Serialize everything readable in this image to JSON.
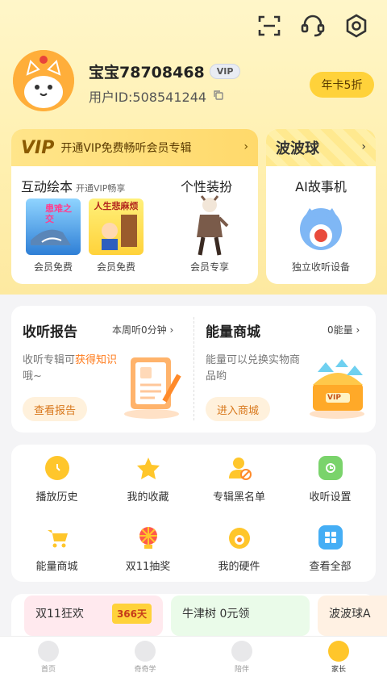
{
  "user": {
    "nickname": "宝宝78708468",
    "vip_label": "VIP",
    "user_id": "用户ID:508541244"
  },
  "header": {
    "year_card_button": "年卡5折"
  },
  "vip_card": {
    "logo": "VIP",
    "banner_text": "开通VIP免费畅听会员专辑",
    "section1_title": "互动绘本",
    "section1_sub": "开通VIP畅享",
    "section2_title": "个性装扮",
    "book1_title": "患难之交",
    "book1_caption": "会员免费",
    "book2_title": "人生悲麻烦",
    "book2_caption": "会员免费",
    "costume_caption": "会员专享"
  },
  "bobo_card": {
    "title": "波波球",
    "product": "AI故事机",
    "caption": "独立收听设备"
  },
  "report": {
    "title": "收听报告",
    "meta": "本周听0分钟",
    "desc_prefix": "收听专辑可",
    "desc_highlight": "获得知识",
    "desc_suffix": "哦~",
    "button": "查看报告"
  },
  "shop": {
    "title": "能量商城",
    "meta": "0能量",
    "desc": "能量可以兑换实物商品哟",
    "button": "进入商城",
    "chest_label": "VIP"
  },
  "grid_items": [
    {
      "label": "播放历史",
      "icon": "clock-icon"
    },
    {
      "label": "我的收藏",
      "icon": "star-icon"
    },
    {
      "label": "专辑黑名单",
      "icon": "user-block-icon"
    },
    {
      "label": "收听设置",
      "icon": "settings-icon"
    },
    {
      "label": "能量商城",
      "icon": "cart-icon"
    },
    {
      "label": "双11抽奖",
      "icon": "lottery-wheel-icon"
    },
    {
      "label": "我的硬件",
      "icon": "device-icon"
    },
    {
      "label": "查看全部",
      "icon": "grid-icon"
    }
  ],
  "promos": [
    {
      "text": "双11狂欢",
      "badge": "366天"
    },
    {
      "text": "牛津树 0元领"
    },
    {
      "text": "波波球A"
    }
  ],
  "tabs": [
    {
      "label": "首页",
      "icon": "home-icon"
    },
    {
      "label": "奇奇学",
      "icon": "learn-icon"
    },
    {
      "label": "陪伴",
      "icon": "companion-icon"
    },
    {
      "label": "家长",
      "icon": "parent-icon"
    }
  ],
  "colors": {
    "accent": "#ffc62b",
    "header_bg": "#fff3be",
    "highlight": "#ff7a1a"
  }
}
